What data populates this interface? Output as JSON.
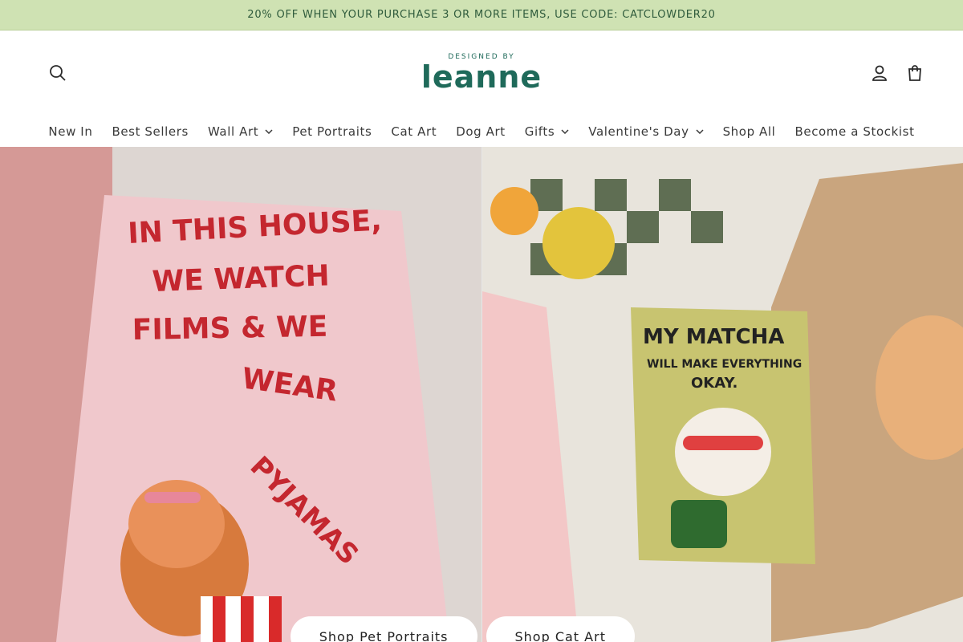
{
  "announcement": "20% OFF WHEN YOUR PURCHASE 3 OR MORE ITEMS, USE CODE: CATCLOWDER20",
  "logo": {
    "tagline": "DESIGNED BY",
    "wordmark": "leanne"
  },
  "nav": [
    {
      "label": "New In"
    },
    {
      "label": "Best Sellers"
    },
    {
      "label": "Wall Art",
      "dropdown": true
    },
    {
      "label": "Pet Portraits"
    },
    {
      "label": "Cat Art"
    },
    {
      "label": "Dog Art"
    },
    {
      "label": "Gifts",
      "dropdown": true
    },
    {
      "label": "Valentine's Day",
      "dropdown": true
    },
    {
      "label": "Shop All"
    },
    {
      "label": "Become a Stockist"
    }
  ],
  "hero": {
    "left": {
      "poster_lines": [
        "IN THIS HOUSE,",
        "WE WATCH",
        "FILMS & WE",
        "WEAR",
        "PYJAMAS"
      ],
      "cta": "Shop Pet Portraits"
    },
    "right": {
      "card_lines": [
        "MY MATCHA",
        "WILL MAKE EVERYTHING",
        "OKAY."
      ],
      "cta": "Shop Cat Art"
    }
  },
  "colors": {
    "announcement_bg": "#cfe2b3",
    "brand_teal": "#1f6a5a",
    "poster_text_red": "#c4272f"
  },
  "icons": [
    "search-icon",
    "account-icon",
    "cart-icon",
    "chevron-down-icon"
  ]
}
